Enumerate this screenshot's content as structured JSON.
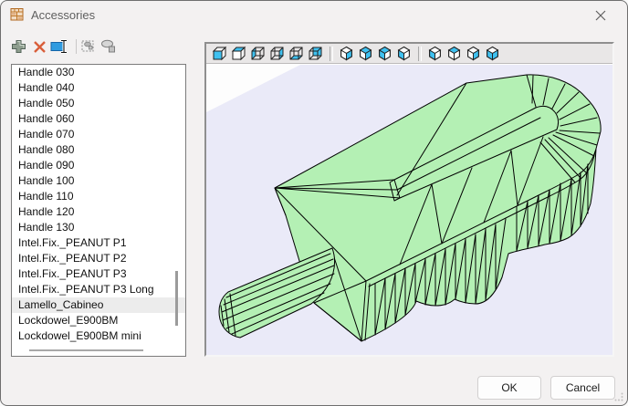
{
  "window": {
    "title": "Accessories"
  },
  "toolbar": {
    "icons": [
      "add",
      "delete",
      "rename",
      "copy-special",
      "clone"
    ]
  },
  "list": {
    "items": [
      "Handle 030",
      "Handle 040",
      "Handle 050",
      "Handle 060",
      "Handle 070",
      "Handle 080",
      "Handle 090",
      "Handle 100",
      "Handle 110",
      "Handle 120",
      "Handle 130",
      "Intel.Fix._PEANUT P1",
      "Intel.Fix._PEANUT P2",
      "Intel.Fix._PEANUT P3",
      "Intel.Fix._PEANUT P3 Long",
      "Lamello_Cabineo",
      "Lockdowel_E900BM",
      "Lockdowel_E900BM mini"
    ],
    "selected_index": 15
  },
  "viewport": {
    "view_buttons": [
      {
        "name": "view-front",
        "variant": "front"
      },
      {
        "name": "view-top",
        "variant": "top"
      },
      {
        "name": "view-left",
        "variant": "left"
      },
      {
        "name": "view-right",
        "variant": "right"
      },
      {
        "name": "view-bottom",
        "variant": "bottom"
      },
      {
        "name": "view-back",
        "variant": "back"
      },
      {
        "name": "view-iso-1",
        "variant": "iso:right"
      },
      {
        "name": "view-iso-2",
        "variant": "iso:right,top"
      },
      {
        "name": "view-iso-3",
        "variant": "iso:left,top"
      },
      {
        "name": "view-iso-4",
        "variant": "iso:left"
      },
      {
        "name": "view-iso-5",
        "variant": "iso:left"
      },
      {
        "name": "view-iso-6",
        "variant": "iso:top"
      },
      {
        "name": "view-iso-7",
        "variant": "iso:right"
      },
      {
        "name": "view-iso-8",
        "variant": "iso:left,right"
      }
    ]
  },
  "buttons": {
    "ok": "OK",
    "cancel": "Cancel"
  },
  "colors": {
    "model_green": "#b4f0b4",
    "ground": "#eaeaf8",
    "face_cyan": "#3fc1f0"
  }
}
